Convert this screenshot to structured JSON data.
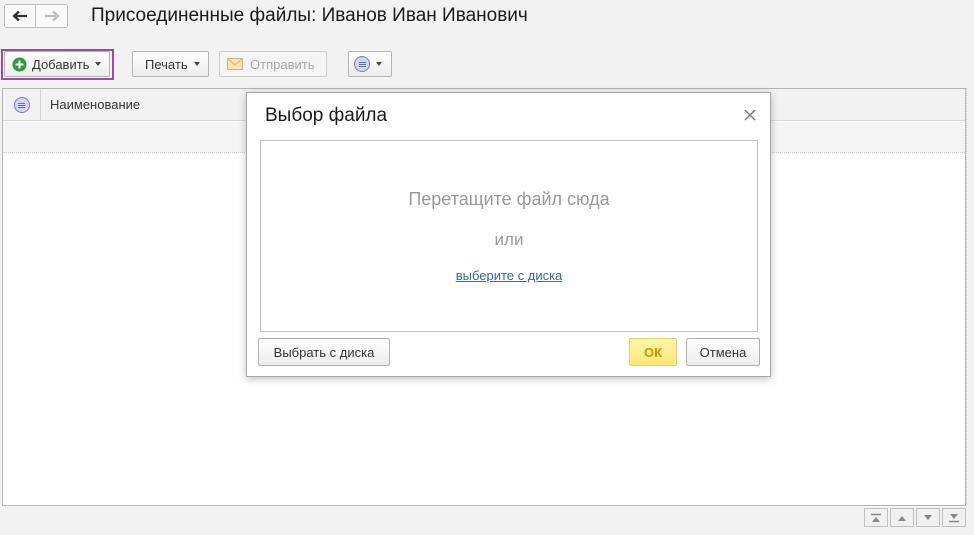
{
  "form": {
    "title": "Присоединенные файлы: Иванов Иван Иванович"
  },
  "nav": {
    "back_icon": "arrow-left-icon",
    "forward_icon": "arrow-right-icon"
  },
  "toolbar": {
    "add_label": "Добавить",
    "print_label": "Печать",
    "send_label": "Отправить",
    "more_icon": "list-circle-icon"
  },
  "grid": {
    "columns": [
      "Наименование"
    ],
    "rows": []
  },
  "dialog": {
    "title": "Выбор файла",
    "drop_text": "Перетащите файл сюда",
    "or_text": "или",
    "link_text": "выберите с диска",
    "choose_label": "Выбрать с диска",
    "ok_label": "ОК",
    "cancel_label": "Отмена"
  },
  "colors": {
    "add_highlight": "#9c4aa8",
    "ok_button": "#fde77a",
    "link": "#3366aa",
    "add_icon": "#2e9a3b"
  }
}
